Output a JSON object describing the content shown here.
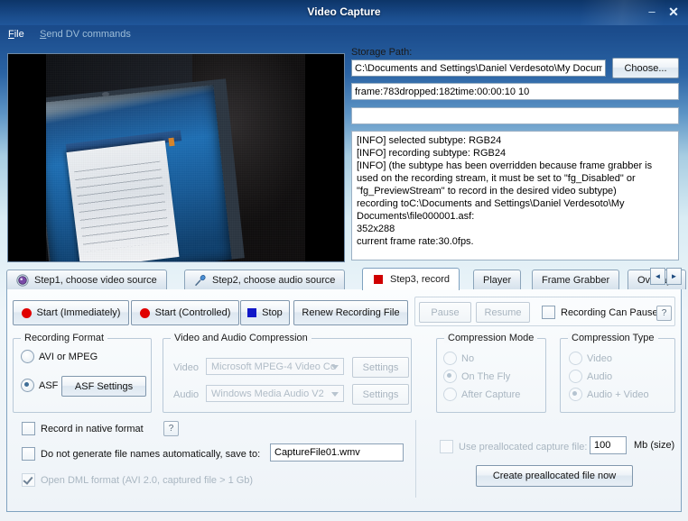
{
  "window": {
    "title": "Video Capture",
    "minimize_label": "–",
    "close_label": "✕"
  },
  "menubar": {
    "items": [
      {
        "label": "File",
        "accel": "F",
        "enabled": true
      },
      {
        "label": "Send DV commands",
        "accel": "S",
        "enabled": false
      }
    ]
  },
  "preview": {
    "name": "video-preview"
  },
  "storage": {
    "label": "Storage Path:",
    "path_value": "C:\\Documents and Settings\\Daniel Verdesoto\\My Docume",
    "choose_label": "Choose..."
  },
  "status": {
    "line1": "frame:783dropped:182time:00:00:10 10",
    "line2": ""
  },
  "log": {
    "text": "[INFO] selected subtype: RGB24\n[INFO] recording subtype: RGB24\n[INFO] (the subtype has been overridden because frame grabber is used on the recording stream, it must be set to \"fg_Disabled\" or \"fg_PreviewStream\" to record in the desired video subtype)\nrecording toC:\\Documents and Settings\\Daniel Verdesoto\\My Documents\\file000001.asf:\n352x288\ncurrent frame rate:30.0fps."
  },
  "tabs": {
    "items": [
      {
        "label": "Step1, choose video source",
        "icon": "webcam-icon",
        "active": false
      },
      {
        "label": "Step2, choose audio source",
        "icon": "microphone-icon",
        "active": false
      },
      {
        "label": "Step3, record",
        "icon": "record-square-icon",
        "active": true
      },
      {
        "label": "Player",
        "icon": "",
        "active": false
      },
      {
        "label": "Frame Grabber",
        "icon": "",
        "active": false
      },
      {
        "label": "Overlays",
        "icon": "",
        "active": false
      }
    ],
    "scroll_left": "◄",
    "scroll_right": "►"
  },
  "toolbar": {
    "start_immediately": "Start (Immediately)",
    "start_controlled": "Start (Controlled)",
    "stop": "Stop",
    "renew": "Renew Recording File",
    "pause": "Pause",
    "resume": "Resume",
    "recording_can_pause": "Recording Can Pause",
    "help": "?"
  },
  "recording_format": {
    "title": "Recording Format",
    "options": [
      {
        "label": "AVI or MPEG",
        "selected": false
      },
      {
        "label": "ASF",
        "selected": true
      }
    ],
    "asf_settings": "ASF Settings"
  },
  "compression": {
    "title": "Video and Audio Compression",
    "video_label": "Video",
    "video_value": "Microsoft MPEG-4 Video Co",
    "video_settings": "Settings",
    "audio_label": "Audio",
    "audio_value": "Windows Media Audio V2",
    "audio_settings": "Settings"
  },
  "compression_mode": {
    "title": "Compression Mode",
    "options": [
      {
        "label": "No",
        "selected": false
      },
      {
        "label": "On The Fly",
        "selected": true
      },
      {
        "label": "After Capture",
        "selected": false
      }
    ]
  },
  "compression_type": {
    "title": "Compression Type",
    "options": [
      {
        "label": "Video",
        "selected": false
      },
      {
        "label": "Audio",
        "selected": false
      },
      {
        "label": "Audio + Video",
        "selected": true
      }
    ]
  },
  "options": {
    "native_format": "Record in native format",
    "native_help": "?",
    "no_autoname": "Do not generate file names automatically, save to:",
    "capture_file_value": "CaptureFile01.wmv",
    "open_dml": "Open DML format (AVI 2.0, captured file > 1 Gb)"
  },
  "preallocated": {
    "use_label": "Use preallocated capture file:",
    "size_value": "100",
    "size_units": "Mb (size)",
    "create_label": "Create preallocated file now"
  },
  "colors": {
    "titlebar": "#14417c",
    "record_red": "#e00000",
    "stop_blue": "#1118c8",
    "panel_bg": "#f3f7fa"
  }
}
